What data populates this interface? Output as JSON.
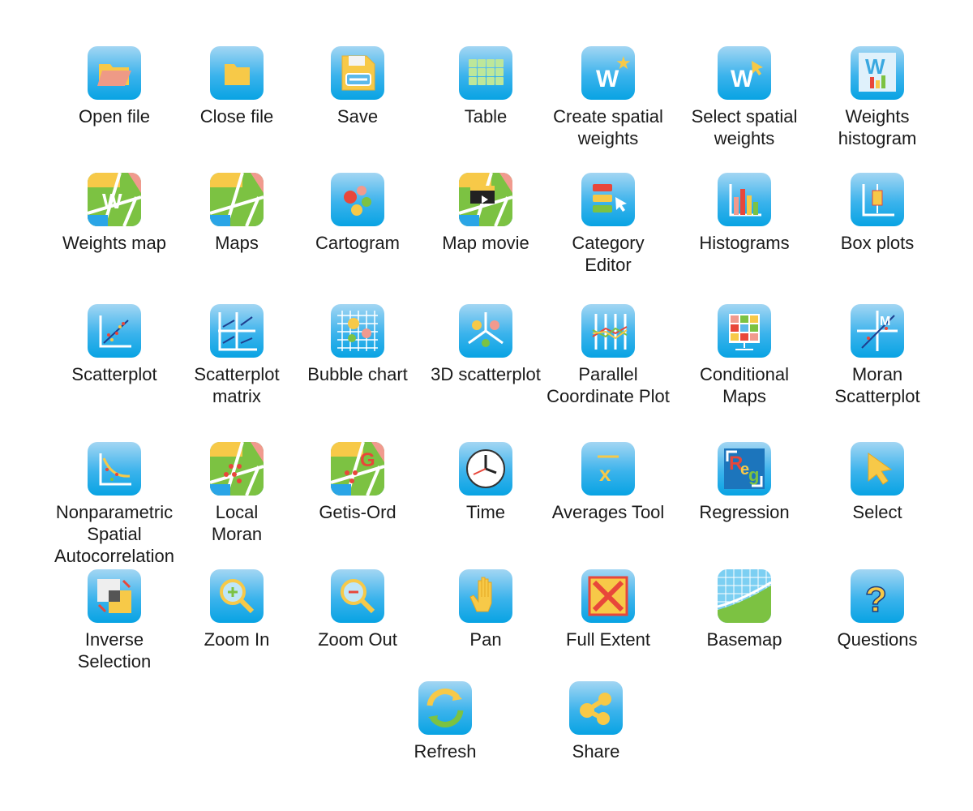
{
  "tools": [
    {
      "label": "Open file",
      "icon": "open-folder-icon"
    },
    {
      "label": "Close file",
      "icon": "folder-icon"
    },
    {
      "label": "Save",
      "icon": "save-icon"
    },
    {
      "label": "Table",
      "icon": "table-icon"
    },
    {
      "label": "Create spatial\nweights",
      "icon": "create-weights-icon"
    },
    {
      "label": "Select spatial\nweights",
      "icon": "select-weights-icon"
    },
    {
      "label": "Weights\nhistogram",
      "icon": "weights-histogram-icon"
    },
    {
      "label": "Weights map",
      "icon": "weights-map-icon"
    },
    {
      "label": "Maps",
      "icon": "map-icon"
    },
    {
      "label": "Cartogram",
      "icon": "cartogram-icon"
    },
    {
      "label": "Map movie",
      "icon": "map-movie-icon"
    },
    {
      "label": "Category\nEditor",
      "icon": "category-editor-icon"
    },
    {
      "label": "Histograms",
      "icon": "histogram-icon"
    },
    {
      "label": "Box plots",
      "icon": "box-plot-icon"
    },
    {
      "label": "Scatterplot",
      "icon": "scatterplot-icon"
    },
    {
      "label": "Scatterplot\nmatrix",
      "icon": "scatterplot-matrix-icon"
    },
    {
      "label": "Bubble chart",
      "icon": "bubble-chart-icon"
    },
    {
      "label": "3D scatterplot",
      "icon": "3d-scatterplot-icon"
    },
    {
      "label": "Parallel\nCoordinate Plot",
      "icon": "parallel-coordinate-icon"
    },
    {
      "label": "Conditional\nMaps",
      "icon": "conditional-maps-icon"
    },
    {
      "label": "Moran\nScatterplot",
      "icon": "moran-scatterplot-icon"
    },
    {
      "label": "Nonparametric\nSpatial\nAutocorrelation",
      "icon": "nonparametric-icon"
    },
    {
      "label": "Local\nMoran",
      "icon": "local-moran-icon"
    },
    {
      "label": "Getis-Ord",
      "icon": "getis-ord-icon"
    },
    {
      "label": "Time",
      "icon": "clock-icon"
    },
    {
      "label": "Averages Tool",
      "icon": "averages-icon"
    },
    {
      "label": "Regression",
      "icon": "regression-icon"
    },
    {
      "label": "Select",
      "icon": "cursor-icon"
    },
    {
      "label": "Inverse\nSelection",
      "icon": "inverse-selection-icon"
    },
    {
      "label": "Zoom In",
      "icon": "zoom-in-icon"
    },
    {
      "label": "Zoom Out",
      "icon": "zoom-out-icon"
    },
    {
      "label": "Pan",
      "icon": "hand-icon"
    },
    {
      "label": "Full Extent",
      "icon": "full-extent-icon"
    },
    {
      "label": "Basemap",
      "icon": "basemap-icon"
    },
    {
      "label": "Questions",
      "icon": "question-icon"
    },
    {
      "label": "Refresh",
      "icon": "refresh-icon"
    },
    {
      "label": "Share",
      "icon": "share-icon"
    }
  ]
}
